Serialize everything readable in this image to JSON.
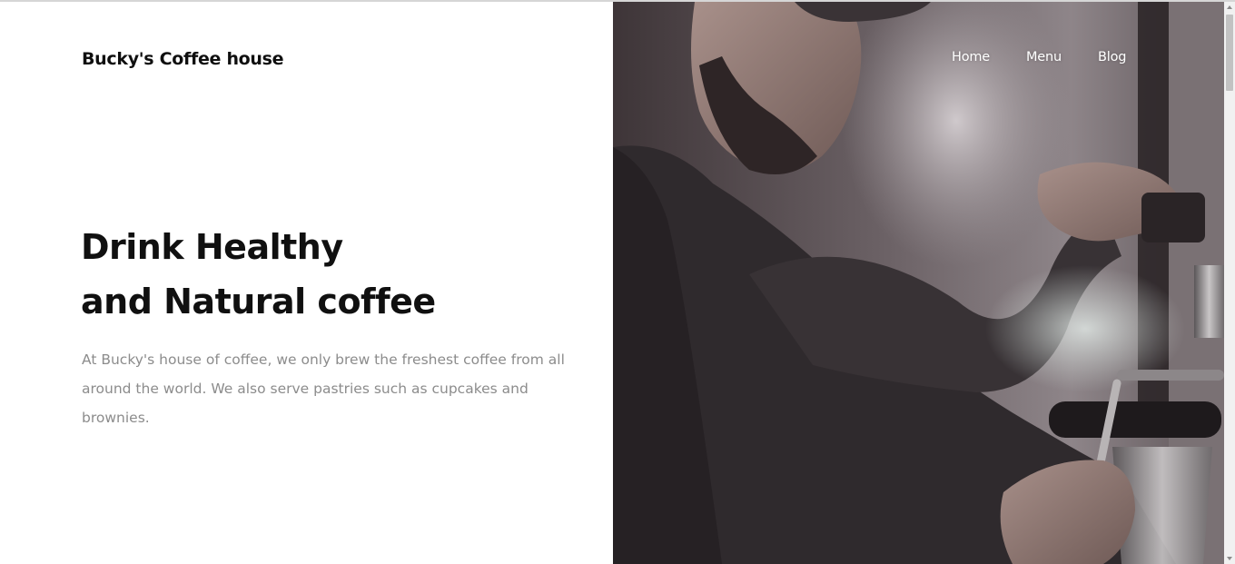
{
  "brand": {
    "name": "Bucky's Coffee house"
  },
  "nav": {
    "items": [
      {
        "label": "Home"
      },
      {
        "label": "Menu"
      },
      {
        "label": "Blog"
      }
    ]
  },
  "hero": {
    "headline_line1": "Drink Healthy",
    "headline_line2": "and Natural coffee",
    "description": "At Bucky's house of coffee, we only brew the freshest coffee from all around the world. We also serve pastries such as cupcakes and brownies."
  },
  "colors": {
    "text_dark": "#101010",
    "text_muted": "#8c8c8c",
    "nav_text": "#ffffff",
    "photo_tone": "#574f52"
  },
  "icons": {
    "scroll_up": "scroll-up-arrow-icon",
    "scroll_down": "scroll-down-arrow-icon"
  }
}
